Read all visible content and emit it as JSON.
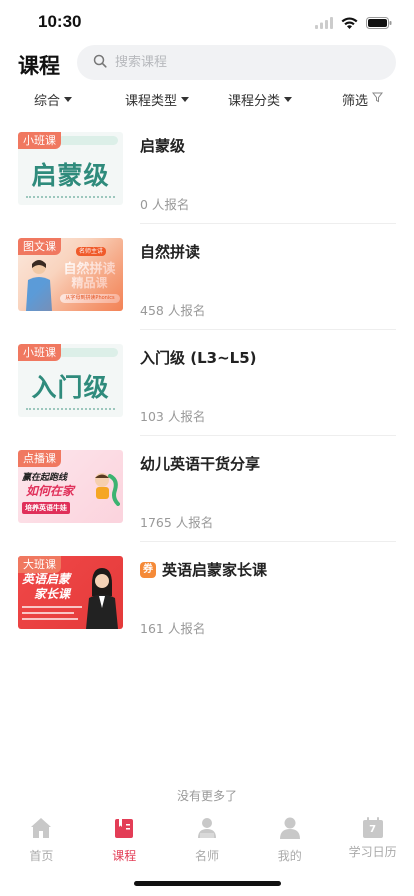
{
  "status_bar": {
    "time": "10:30"
  },
  "header": {
    "title": "课程",
    "search_placeholder": "搜索课程"
  },
  "filters": [
    {
      "label": "综合"
    },
    {
      "label": "课程类型"
    },
    {
      "label": "课程分类"
    },
    {
      "label": "筛选"
    }
  ],
  "courses": [
    {
      "tag": "小班课",
      "thumb_text": "启蒙级",
      "title": "启蒙级",
      "enroll": "0 人报名"
    },
    {
      "tag": "图文课",
      "thumb_line1": "自然拼读",
      "thumb_line2": "精品课",
      "thumb_sub": "从字母到拼读Phonics",
      "thumb_badge": "名师主讲",
      "title": "自然拼读",
      "enroll": "458 人报名"
    },
    {
      "tag": "小班课",
      "thumb_text": "入门级",
      "title": "入门级 (L3~L5)",
      "enroll": "103 人报名"
    },
    {
      "tag": "点播课",
      "thumb_line1": "赢在起跑线",
      "thumb_line2": "如何在家",
      "thumb_line3": "培养英语牛娃",
      "title": "幼儿英语干货分享",
      "enroll": "1765 人报名"
    },
    {
      "tag": "大班课",
      "thumb_line1": "英语启蒙",
      "thumb_line2": "家长课",
      "coupon": "券",
      "title": "英语启蒙家长课",
      "enroll": "161 人报名"
    }
  ],
  "no_more": "没有更多了",
  "tabbar": [
    {
      "label": "首页",
      "icon": "home-icon"
    },
    {
      "label": "课程",
      "icon": "course-book-icon",
      "active": true
    },
    {
      "label": "名师",
      "icon": "teacher-icon"
    },
    {
      "label": "我的",
      "icon": "profile-icon"
    },
    {
      "label": "学习日历",
      "icon": "calendar-icon",
      "badge": "7"
    }
  ],
  "colors": {
    "accent": "#e33d56",
    "tag": "#f07860",
    "coupon": "#f58a38"
  }
}
